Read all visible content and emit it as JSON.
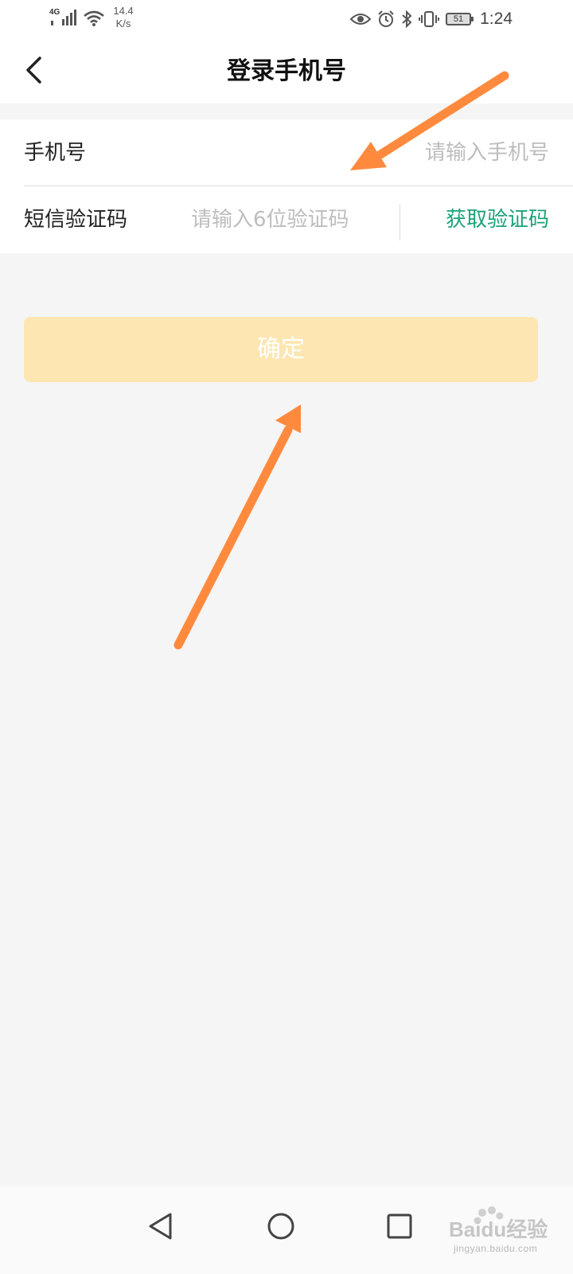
{
  "status_bar": {
    "network": "4G",
    "speed_value": "14.4",
    "speed_unit": "K/s",
    "battery": "51",
    "time": "1:24",
    "icons": [
      "signal-icon",
      "wifi-icon",
      "eye-icon",
      "alarm-icon",
      "bluetooth-icon",
      "vibrate-icon",
      "battery-icon"
    ]
  },
  "header": {
    "title": "登录手机号",
    "back_icon": "chevron-left-icon"
  },
  "form": {
    "phone": {
      "label": "手机号",
      "value": "",
      "placeholder": "请输入手机号"
    },
    "code": {
      "label": "短信验证码",
      "value": "",
      "placeholder": "请输入6位验证码",
      "action_label": "获取验证码"
    }
  },
  "confirm": {
    "label": "确定"
  },
  "colors": {
    "accent_green": "#1aa37a",
    "confirm_bg": "#fde6b2",
    "annotation_arrow": "#ff8a3d",
    "page_bg": "#f5f5f5"
  },
  "nav_bar": {
    "icons": [
      "triangle-back-icon",
      "circle-home-icon",
      "square-recent-icon"
    ]
  },
  "watermark": {
    "brand": "Baidu经验",
    "url": "jingyan.baidu.com"
  }
}
